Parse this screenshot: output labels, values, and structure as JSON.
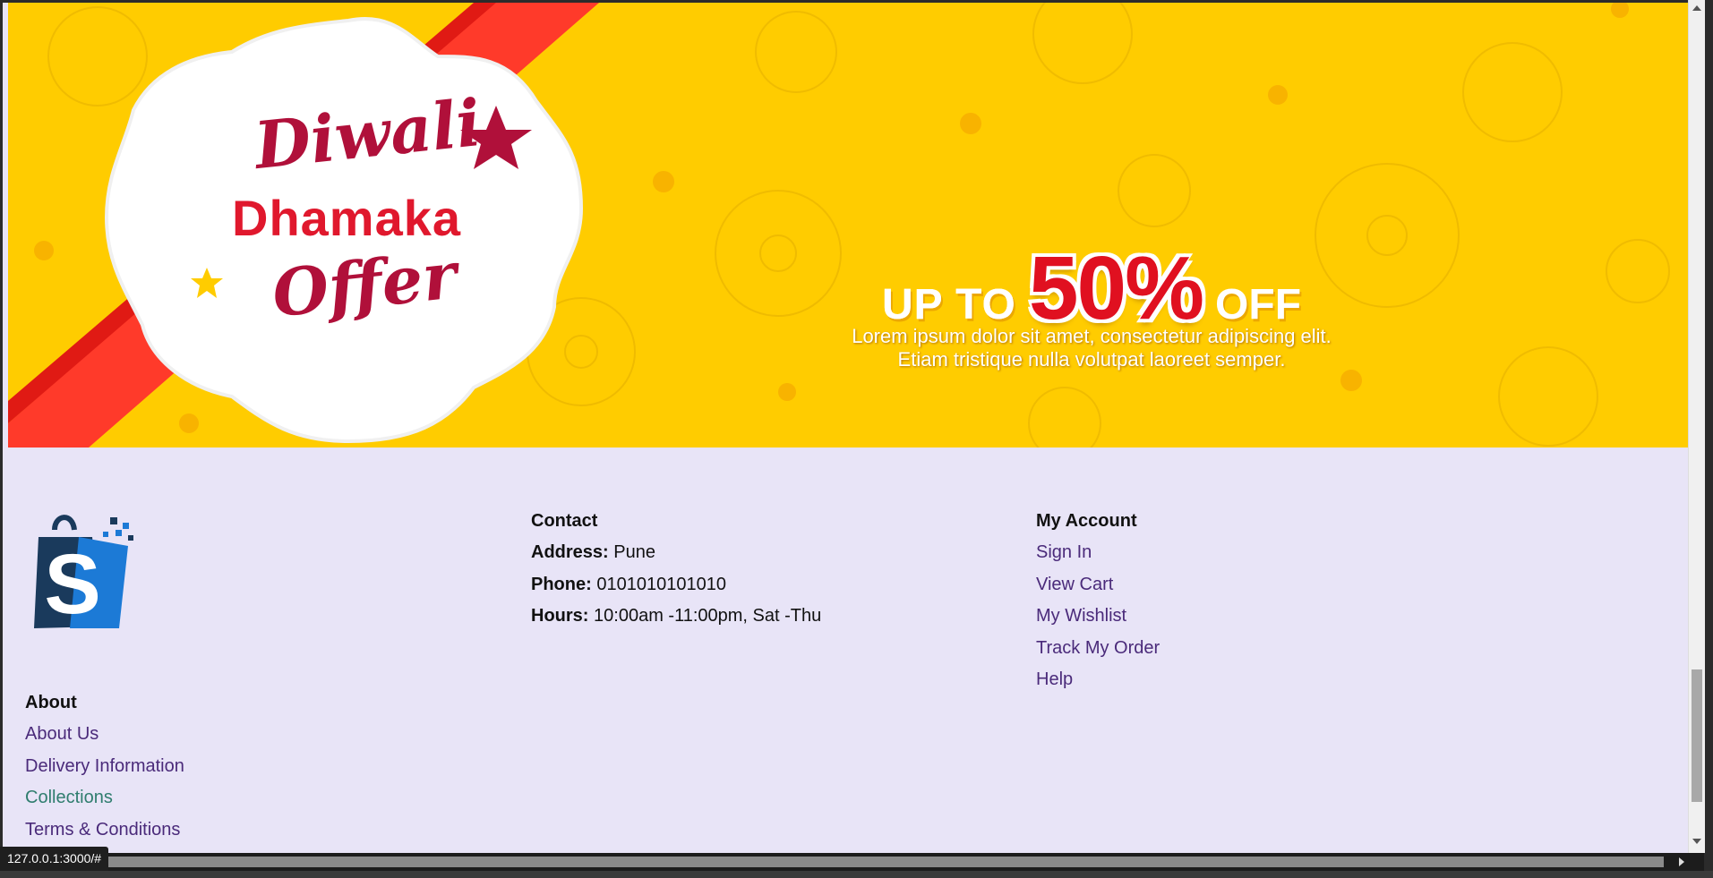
{
  "banner": {
    "title_line1": "Diwali",
    "title_line2": "Dhamaka",
    "title_line3": "Offer",
    "up_to": "UP TO",
    "percent": "50%",
    "off": "OFF",
    "subtitle_line1": "Lorem ipsum dolor sit amet, consectetur adipiscing elit.",
    "subtitle_line2": "Etiam tristique nulla volutpat laoreet semper."
  },
  "footer": {
    "contact": {
      "heading": "Contact",
      "address_label": "Address:",
      "address_value": "Pune",
      "phone_label": "Phone:",
      "phone_value": "0101010101010",
      "hours_label": "Hours:",
      "hours_value": "10:00am -11:00pm, Sat -Thu"
    },
    "account": {
      "heading": "My Account",
      "links": [
        "Sign In",
        "View Cart",
        "My Wishlist",
        "Track My Order",
        "Help"
      ]
    },
    "about": {
      "heading": "About",
      "links": [
        "About Us",
        "Delivery Information",
        "Collections",
        "Terms & Conditions"
      ]
    }
  },
  "status_bar": {
    "url": "127.0.0.1:3000/#"
  },
  "colors": {
    "banner_bg": "#ffcc00",
    "footer_bg": "#e8e4f7",
    "link": "#4a2a7a",
    "visited_link": "#2f7d6e",
    "accent_red": "#e01020",
    "logo_dark": "#1a3a5c",
    "logo_blue": "#1c7ad6"
  },
  "icons": {
    "logo": "shopping-bag-s-logo"
  }
}
